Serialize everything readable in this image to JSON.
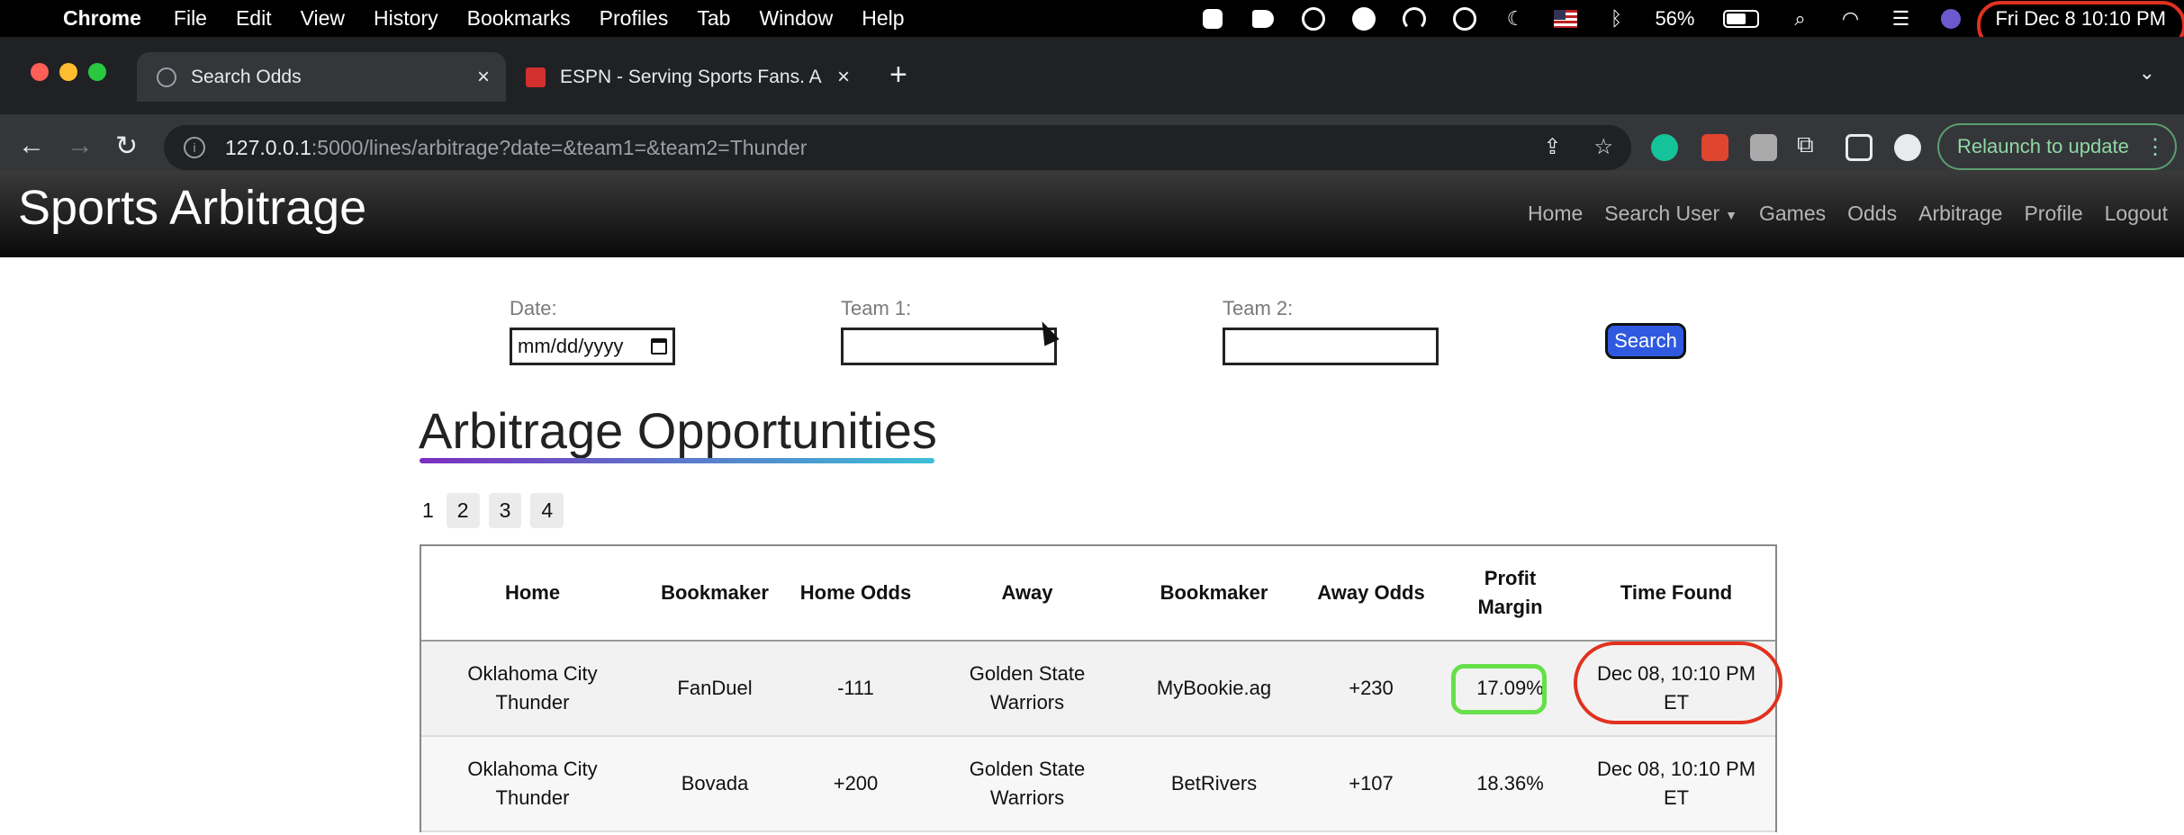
{
  "menubar": {
    "app_name": "Chrome",
    "items": [
      "File",
      "Edit",
      "View",
      "History",
      "Bookmarks",
      "Profiles",
      "Tab",
      "Window",
      "Help"
    ],
    "battery_percent": "56%",
    "datetime": "Fri Dec 8  10:10 PM"
  },
  "tabs": [
    {
      "title": "Search Odds",
      "active": true
    },
    {
      "title": "ESPN - Serving Sports Fans. A",
      "active": false
    }
  ],
  "toolbar": {
    "url_host": "127.0.0.1",
    "url_rest": ":5000/lines/arbitrage?date=&team1=&team2=Thunder",
    "relaunch_label": "Relaunch to update"
  },
  "navbar": {
    "brand": "Sports Arbitrage",
    "links": [
      "Home",
      "Search User",
      "Games",
      "Odds",
      "Arbitrage",
      "Profile",
      "Logout"
    ]
  },
  "form": {
    "date_label": "Date:",
    "date_placeholder": "mm/dd/yyyy",
    "team1_label": "Team 1:",
    "team1_value": "",
    "team2_label": "Team 2:",
    "team2_value": "",
    "search_label": "Search"
  },
  "heading": "Arbitrage Opportunities",
  "pagination": {
    "current": "1",
    "pages": [
      "2",
      "3",
      "4"
    ]
  },
  "table": {
    "headers": [
      "Home",
      "Bookmaker",
      "Home Odds",
      "Away",
      "Bookmaker",
      "Away Odds",
      "Profit Margin",
      "Time Found"
    ],
    "rows": [
      [
        "Oklahoma City Thunder",
        "FanDuel",
        "-111",
        "Golden State Warriors",
        "MyBookie.ag",
        "+230",
        "17.09%",
        "Dec 08, 10:10 PM ET"
      ],
      [
        "Oklahoma City Thunder",
        "Bovada",
        "+200",
        "Golden State Warriors",
        "BetRivers",
        "+107",
        "18.36%",
        "Dec 08, 10:10 PM ET"
      ]
    ]
  },
  "colors": {
    "annotation_red": "#e0321f",
    "annotation_green": "#66e04a",
    "search_button": "#2f5ae0",
    "relaunch_green": "#8fd8a5"
  }
}
